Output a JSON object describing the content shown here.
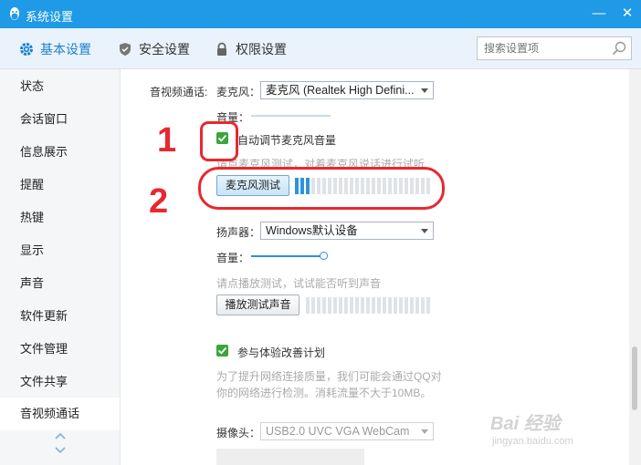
{
  "window": {
    "title": "系统设置",
    "minimize": "—",
    "close": "✕",
    "logo_icon": "qq-penguin-icon"
  },
  "tabs": [
    {
      "label": "基本设置",
      "icon": "gear-icon",
      "active": true
    },
    {
      "label": "安全设置",
      "icon": "shield-icon",
      "active": false
    },
    {
      "label": "权限设置",
      "icon": "lock-icon",
      "active": false
    }
  ],
  "search": {
    "placeholder": "搜索设置项",
    "icon": "search-icon"
  },
  "sidebar": {
    "items": [
      {
        "label": "状态"
      },
      {
        "label": "会话窗口"
      },
      {
        "label": "信息展示"
      },
      {
        "label": "提醒"
      },
      {
        "label": "热键"
      },
      {
        "label": "显示"
      },
      {
        "label": "声音"
      },
      {
        "label": "软件更新"
      },
      {
        "label": "文件管理"
      },
      {
        "label": "文件共享"
      },
      {
        "label": "音视频通话",
        "active": true
      }
    ]
  },
  "av": {
    "section_label": "音视频通话:",
    "mic": {
      "label": "麦克风：",
      "selected": "麦克风 (Realtek High Defini...",
      "volume_label": "音量：",
      "auto_adjust_label": "自动调节麦克风音量",
      "auto_adjust_checked": true,
      "test_hint": "请点麦克风测试，对着麦克风说话进行试听",
      "test_button": "麦克风测试",
      "meter_active_bars": 3,
      "meter_total_bars": 25
    },
    "speaker": {
      "label": "扬声器：",
      "selected": "Windows默认设备",
      "volume_label": "音量：",
      "volume_level": 0.95,
      "test_hint": "请点播放测试，试试能否听到声音",
      "test_button": "播放测试声音",
      "meter_active_bars": 0,
      "meter_total_bars": 23
    },
    "experience": {
      "label": "参与体验改善计划",
      "checked": true,
      "description_line1": "为了提升网络连接质量，我们可能会通过QQ对",
      "description_line2": "你的网络进行检测。消耗流量不大于10MB。"
    },
    "camera": {
      "label": "摄像头：",
      "selected": "USB2.0 UVC VGA WebCam"
    }
  },
  "annotations": {
    "step1": "1",
    "step2": "2"
  },
  "watermark": {
    "logo": "Bai 经验",
    "url": "jingyan.baidu.com"
  },
  "colors": {
    "accent": "#1e9ae6",
    "annotation": "#e8282f",
    "check": "#3aa53b"
  }
}
